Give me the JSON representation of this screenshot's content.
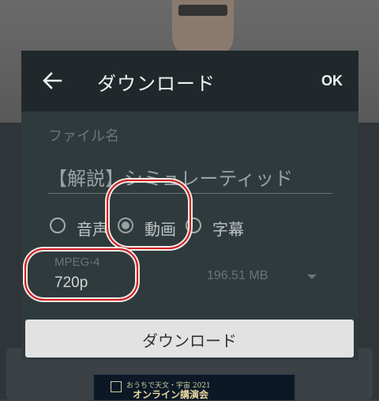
{
  "background": {
    "thumbnail_line1": "おうちで天文・宇宙 2021",
    "thumbnail_line2": "オンライン講演会"
  },
  "dialog": {
    "title": "ダウンロード",
    "back_icon": "arrow-left-icon",
    "ok_label": "OK",
    "file_name_label": "ファイル名",
    "file_name_value": "【解説】シミュレーティッド",
    "options": [
      {
        "label": "音声",
        "selected": false
      },
      {
        "label": "動画",
        "selected": true
      },
      {
        "label": "字幕",
        "selected": false
      }
    ],
    "format_label": "MPEG-4",
    "quality_value": "720p",
    "file_size": "196.51 MB",
    "dropdown_icon": "triangle-down-icon",
    "download_button": "ダウンロード"
  },
  "colors": {
    "header_bg": "#20282b",
    "dialog_bg": "#2f3a3d",
    "annotation_red": "#d32020"
  }
}
